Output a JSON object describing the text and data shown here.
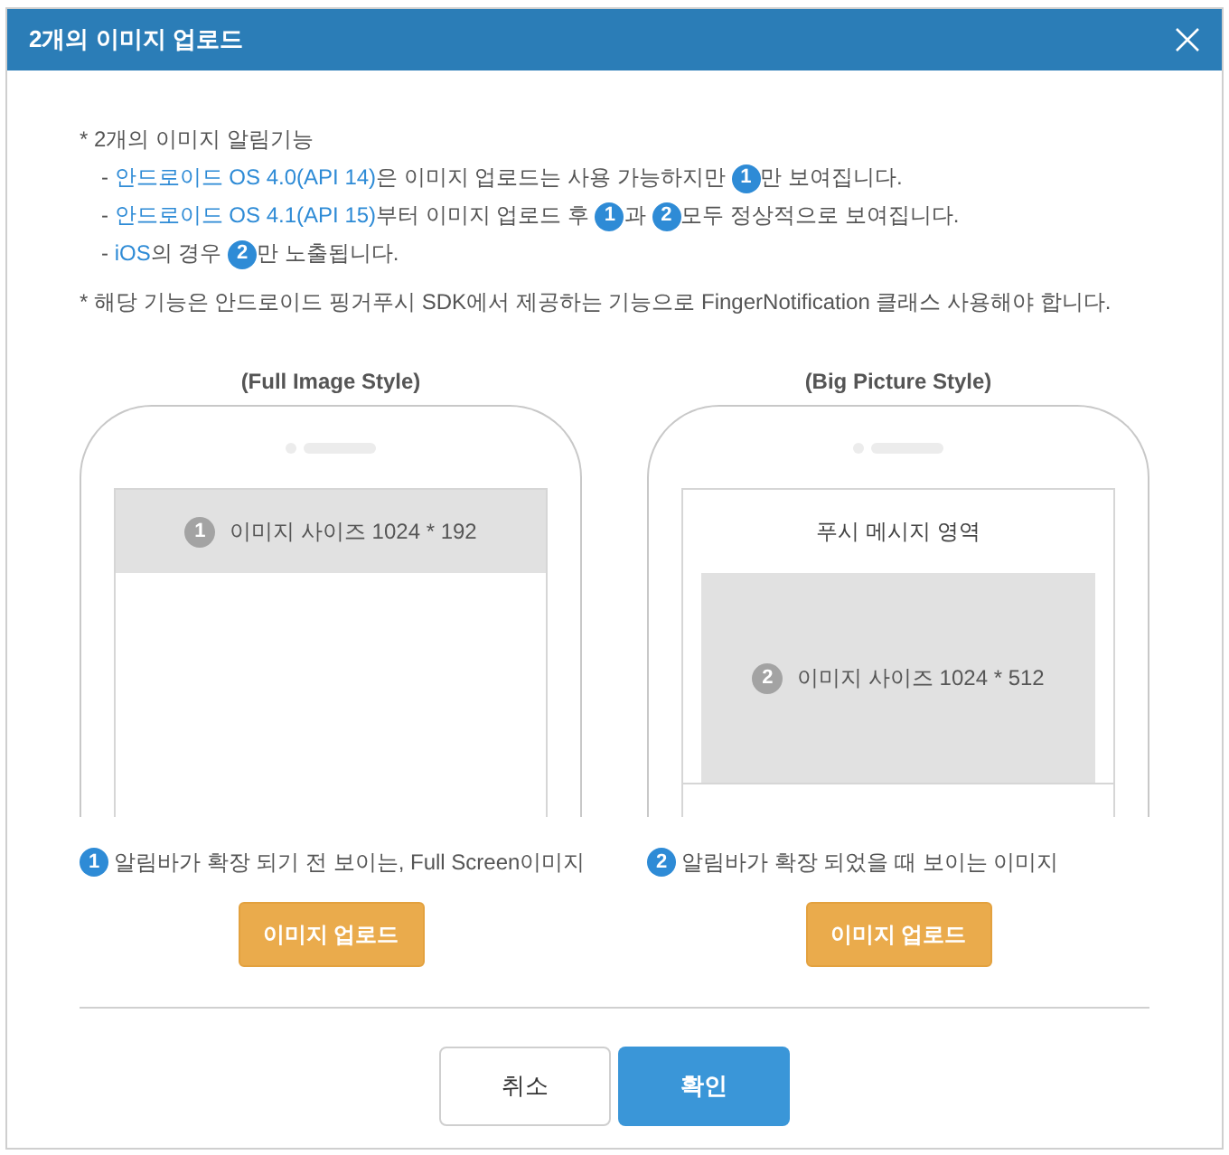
{
  "dialog": {
    "title": "2개의 이미지 업로드"
  },
  "notes": [
    {
      "kind": "heading",
      "segments": [
        {
          "kind": "text",
          "text": "* 2개의 이미지 알림기능"
        }
      ]
    },
    {
      "kind": "sub",
      "segments": [
        {
          "kind": "text",
          "text": "- "
        },
        {
          "kind": "link",
          "text": "안드로이드 OS 4.0(API 14)"
        },
        {
          "kind": "text",
          "text": "은 이미지 업로드는 사용 가능하지만 "
        },
        {
          "kind": "badge",
          "text": "1"
        },
        {
          "kind": "text",
          "text": "만 보여집니다."
        }
      ]
    },
    {
      "kind": "sub",
      "segments": [
        {
          "kind": "text",
          "text": "- "
        },
        {
          "kind": "link",
          "text": "안드로이드 OS 4.1(API 15)"
        },
        {
          "kind": "text",
          "text": "부터 이미지 업로드 후 "
        },
        {
          "kind": "badge",
          "text": "1"
        },
        {
          "kind": "text",
          "text": "과 "
        },
        {
          "kind": "badge",
          "text": "2"
        },
        {
          "kind": "text",
          "text": "모두 정상적으로 보여집니다."
        }
      ]
    },
    {
      "kind": "sub",
      "segments": [
        {
          "kind": "text",
          "text": "- "
        },
        {
          "kind": "link",
          "text": "iOS"
        },
        {
          "kind": "text",
          "text": "의 경우 "
        },
        {
          "kind": "badge",
          "text": "2"
        },
        {
          "kind": "text",
          "text": "만 노출됩니다."
        }
      ]
    },
    {
      "kind": "heading",
      "segments": [
        {
          "kind": "text",
          "text": "* 해당 기능은 안드로이드 핑거푸시 SDK에서 제공하는 기능으로 FingerNotification 클래스 사용해야 합니다."
        }
      ]
    }
  ],
  "previews": [
    {
      "kind": "full_image",
      "style_label": "(Full Image Style)",
      "image": {
        "badge": "1",
        "text": "이미지 사이즈 1024 * 192"
      },
      "caption": {
        "badge": "1",
        "text": "알림바가 확장 되기 전 보이는, Full Screen이미지"
      },
      "button": "이미지 업로드"
    },
    {
      "kind": "big_picture",
      "style_label": "(Big Picture Style)",
      "header": "푸시 메시지 영역",
      "image": {
        "badge": "2",
        "text": "이미지 사이즈 1024 * 512"
      },
      "caption": {
        "badge": "2",
        "text": "알림바가 확장 되었을 때 보이는 이미지"
      },
      "button": "이미지 업로드"
    }
  ],
  "footer_buttons": [
    {
      "kind": "secondary",
      "label": "취소"
    },
    {
      "kind": "primary",
      "label": "확인"
    }
  ]
}
